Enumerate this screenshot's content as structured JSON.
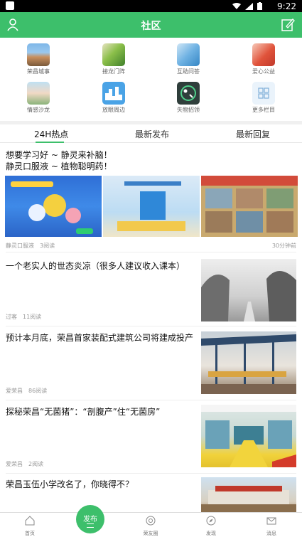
{
  "status_bar": {
    "time": "9:22"
  },
  "app_bar": {
    "title": "社区"
  },
  "categories": [
    {
      "label": "荣昌城事",
      "icon": "city-photo-icon"
    },
    {
      "label": "接龙门阵",
      "icon": "chat-photo-icon"
    },
    {
      "label": "互助问答",
      "icon": "qa-photo-icon"
    },
    {
      "label": "爱心公益",
      "icon": "charity-photo-icon"
    },
    {
      "label": "情感沙龙",
      "icon": "emotion-photo-icon"
    },
    {
      "label": "放眼周边",
      "icon": "city-skyline-icon"
    },
    {
      "label": "失物招领",
      "icon": "lost-found-icon"
    },
    {
      "label": "更多栏目",
      "icon": "grid-more-icon"
    }
  ],
  "tabs": [
    {
      "label": "24H热点",
      "active": true
    },
    {
      "label": "最新发布",
      "active": false
    },
    {
      "label": "最新回复",
      "active": false
    }
  ],
  "featured_post": {
    "title_line1": "想要学习好 ~ 静灵来补脑！",
    "title_line2": "静灵口服液 ~ 植物聪明药！",
    "author": "静灵口服液",
    "reads": "3阅读",
    "time": "30分钟前"
  },
  "posts": [
    {
      "title": "一个老实人的世态炎凉（很多人建议收入课本）",
      "author": "过客",
      "reads": "11阅读"
    },
    {
      "title": "预计本月底，荣昌首家装配式建筑公司将建成投产",
      "author": "爱荣昌",
      "reads": "86阅读"
    },
    {
      "title": "探秘荣昌“无菌猪”：“剖腹产”住“无菌房”",
      "author": "爱荣昌",
      "reads": "2阅读"
    },
    {
      "title": "荣昌玉伍小学改名了，你晓得不？",
      "author": "",
      "reads": ""
    }
  ],
  "bottom_nav": {
    "home": "首页",
    "publish": "发布",
    "friends": "荣友圈",
    "discover": "发现",
    "messages": "消息"
  },
  "colors": {
    "brand": "#3dbf6b"
  }
}
